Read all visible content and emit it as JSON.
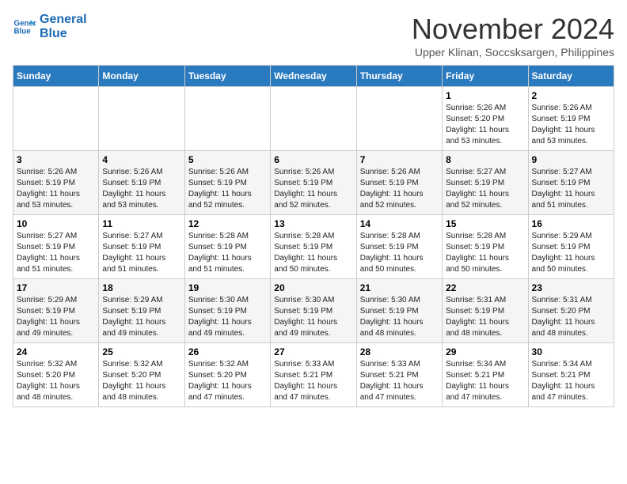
{
  "logo": {
    "line1": "General",
    "line2": "Blue"
  },
  "title": "November 2024",
  "location": "Upper Klinan, Soccsksargen, Philippines",
  "days_of_week": [
    "Sunday",
    "Monday",
    "Tuesday",
    "Wednesday",
    "Thursday",
    "Friday",
    "Saturday"
  ],
  "weeks": [
    [
      {
        "day": "",
        "info": ""
      },
      {
        "day": "",
        "info": ""
      },
      {
        "day": "",
        "info": ""
      },
      {
        "day": "",
        "info": ""
      },
      {
        "day": "",
        "info": ""
      },
      {
        "day": "1",
        "info": "Sunrise: 5:26 AM\nSunset: 5:20 PM\nDaylight: 11 hours\nand 53 minutes."
      },
      {
        "day": "2",
        "info": "Sunrise: 5:26 AM\nSunset: 5:19 PM\nDaylight: 11 hours\nand 53 minutes."
      }
    ],
    [
      {
        "day": "3",
        "info": "Sunrise: 5:26 AM\nSunset: 5:19 PM\nDaylight: 11 hours\nand 53 minutes."
      },
      {
        "day": "4",
        "info": "Sunrise: 5:26 AM\nSunset: 5:19 PM\nDaylight: 11 hours\nand 53 minutes."
      },
      {
        "day": "5",
        "info": "Sunrise: 5:26 AM\nSunset: 5:19 PM\nDaylight: 11 hours\nand 52 minutes."
      },
      {
        "day": "6",
        "info": "Sunrise: 5:26 AM\nSunset: 5:19 PM\nDaylight: 11 hours\nand 52 minutes."
      },
      {
        "day": "7",
        "info": "Sunrise: 5:26 AM\nSunset: 5:19 PM\nDaylight: 11 hours\nand 52 minutes."
      },
      {
        "day": "8",
        "info": "Sunrise: 5:27 AM\nSunset: 5:19 PM\nDaylight: 11 hours\nand 52 minutes."
      },
      {
        "day": "9",
        "info": "Sunrise: 5:27 AM\nSunset: 5:19 PM\nDaylight: 11 hours\nand 51 minutes."
      }
    ],
    [
      {
        "day": "10",
        "info": "Sunrise: 5:27 AM\nSunset: 5:19 PM\nDaylight: 11 hours\nand 51 minutes."
      },
      {
        "day": "11",
        "info": "Sunrise: 5:27 AM\nSunset: 5:19 PM\nDaylight: 11 hours\nand 51 minutes."
      },
      {
        "day": "12",
        "info": "Sunrise: 5:28 AM\nSunset: 5:19 PM\nDaylight: 11 hours\nand 51 minutes."
      },
      {
        "day": "13",
        "info": "Sunrise: 5:28 AM\nSunset: 5:19 PM\nDaylight: 11 hours\nand 50 minutes."
      },
      {
        "day": "14",
        "info": "Sunrise: 5:28 AM\nSunset: 5:19 PM\nDaylight: 11 hours\nand 50 minutes."
      },
      {
        "day": "15",
        "info": "Sunrise: 5:28 AM\nSunset: 5:19 PM\nDaylight: 11 hours\nand 50 minutes."
      },
      {
        "day": "16",
        "info": "Sunrise: 5:29 AM\nSunset: 5:19 PM\nDaylight: 11 hours\nand 50 minutes."
      }
    ],
    [
      {
        "day": "17",
        "info": "Sunrise: 5:29 AM\nSunset: 5:19 PM\nDaylight: 11 hours\nand 49 minutes."
      },
      {
        "day": "18",
        "info": "Sunrise: 5:29 AM\nSunset: 5:19 PM\nDaylight: 11 hours\nand 49 minutes."
      },
      {
        "day": "19",
        "info": "Sunrise: 5:30 AM\nSunset: 5:19 PM\nDaylight: 11 hours\nand 49 minutes."
      },
      {
        "day": "20",
        "info": "Sunrise: 5:30 AM\nSunset: 5:19 PM\nDaylight: 11 hours\nand 49 minutes."
      },
      {
        "day": "21",
        "info": "Sunrise: 5:30 AM\nSunset: 5:19 PM\nDaylight: 11 hours\nand 48 minutes."
      },
      {
        "day": "22",
        "info": "Sunrise: 5:31 AM\nSunset: 5:19 PM\nDaylight: 11 hours\nand 48 minutes."
      },
      {
        "day": "23",
        "info": "Sunrise: 5:31 AM\nSunset: 5:20 PM\nDaylight: 11 hours\nand 48 minutes."
      }
    ],
    [
      {
        "day": "24",
        "info": "Sunrise: 5:32 AM\nSunset: 5:20 PM\nDaylight: 11 hours\nand 48 minutes."
      },
      {
        "day": "25",
        "info": "Sunrise: 5:32 AM\nSunset: 5:20 PM\nDaylight: 11 hours\nand 48 minutes."
      },
      {
        "day": "26",
        "info": "Sunrise: 5:32 AM\nSunset: 5:20 PM\nDaylight: 11 hours\nand 47 minutes."
      },
      {
        "day": "27",
        "info": "Sunrise: 5:33 AM\nSunset: 5:21 PM\nDaylight: 11 hours\nand 47 minutes."
      },
      {
        "day": "28",
        "info": "Sunrise: 5:33 AM\nSunset: 5:21 PM\nDaylight: 11 hours\nand 47 minutes."
      },
      {
        "day": "29",
        "info": "Sunrise: 5:34 AM\nSunset: 5:21 PM\nDaylight: 11 hours\nand 47 minutes."
      },
      {
        "day": "30",
        "info": "Sunrise: 5:34 AM\nSunset: 5:21 PM\nDaylight: 11 hours\nand 47 minutes."
      }
    ]
  ]
}
